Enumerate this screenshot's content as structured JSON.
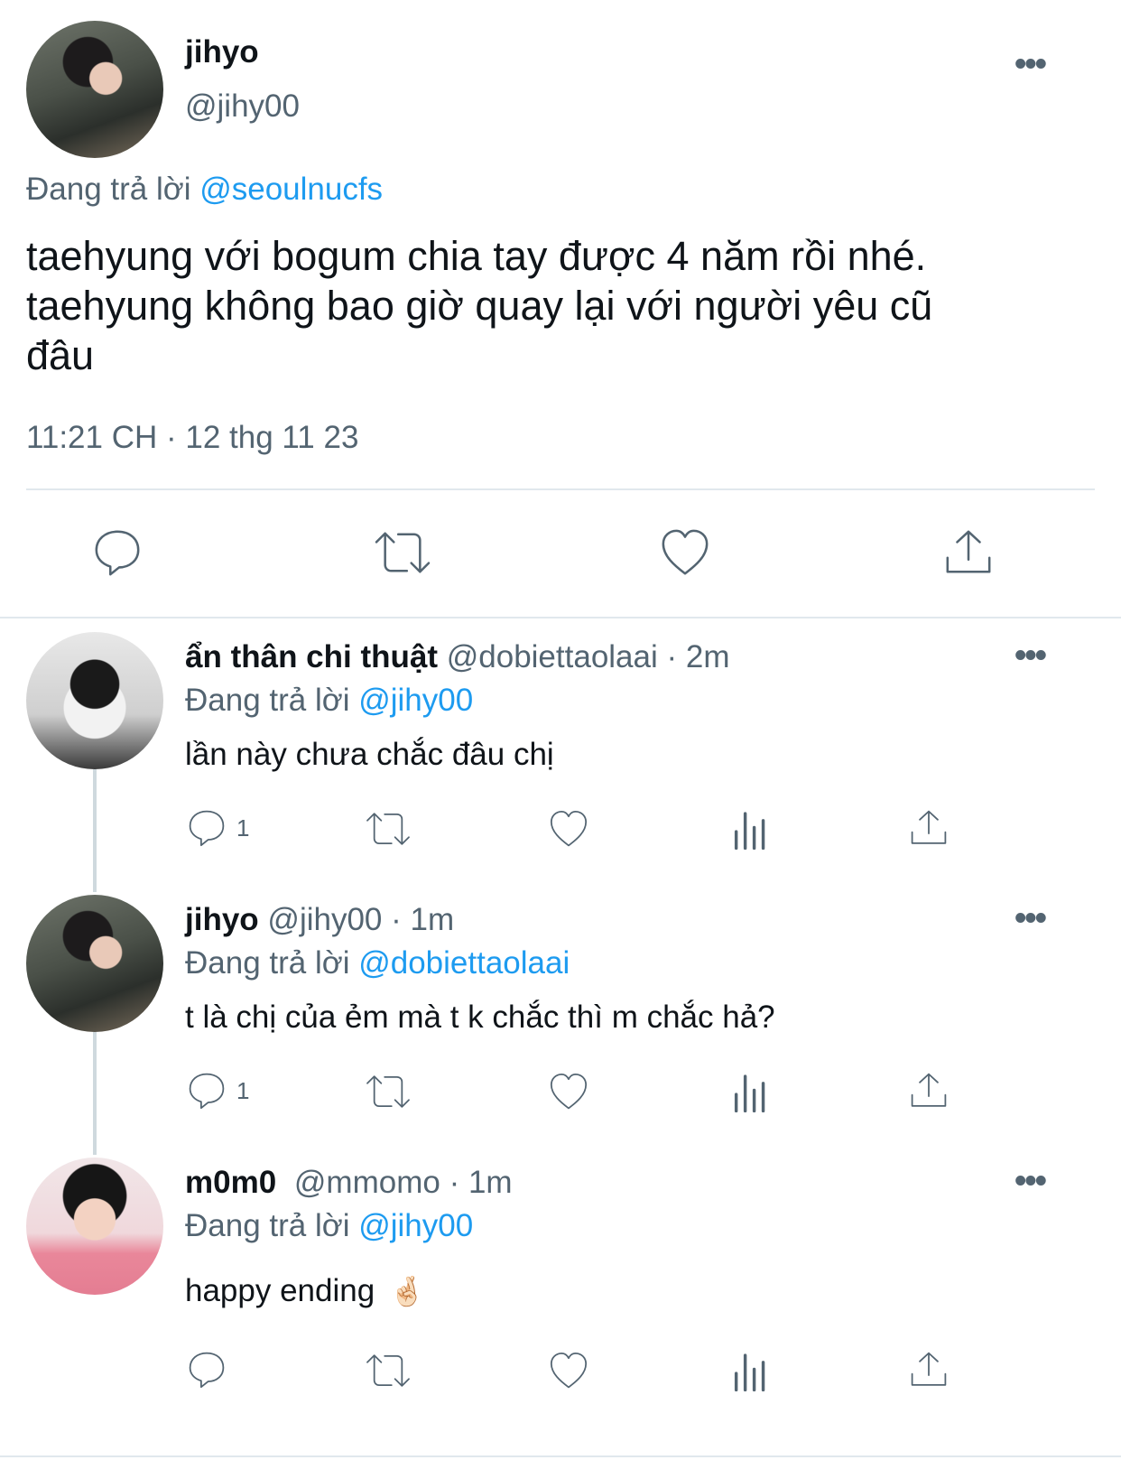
{
  "main_tweet": {
    "name": "jihyo",
    "handle": "@jihy00",
    "replying_prefix": "Đang trả lời",
    "replying_to": "@seoulnucfs",
    "text_line1": "taehyung với bogum chia tay được 4 năm rồi nhé.",
    "text_line2": "taehyung không bao giờ quay lại với người yêu cũ",
    "text_line3": "đâu",
    "time": "11:21 CH",
    "separator": "·",
    "date": "12 thg 11 23",
    "more_icon": "more-icon"
  },
  "replies": [
    {
      "name": "ẩn thân chi thuật",
      "handle": "@dobiettaolaai",
      "separator": "·",
      "time": "2m",
      "replying_prefix": "Đang trả lời",
      "replying_to": "@jihy00",
      "text": "lần này chưa chắc đâu chị",
      "reply_count": "1"
    },
    {
      "name": "jihyo",
      "handle": "@jihy00",
      "separator": "·",
      "time": "1m",
      "replying_prefix": "Đang trả lời",
      "replying_to": "@dobiettaolaai",
      "text": "t là chị của ẻm mà t k chắc thì m chắc hả?",
      "reply_count": "1"
    },
    {
      "name": "m0m0",
      "handle": "@mmomo",
      "separator": "·",
      "time": "1m",
      "replying_prefix": "Đang trả lời",
      "replying_to": "@jihy00",
      "text": "happy ending",
      "emoji": "🤞🏻",
      "reply_count": ""
    }
  ],
  "colors": {
    "link": "#1d9bf0",
    "secondary": "#536471",
    "divider": "#e1e8ed"
  }
}
